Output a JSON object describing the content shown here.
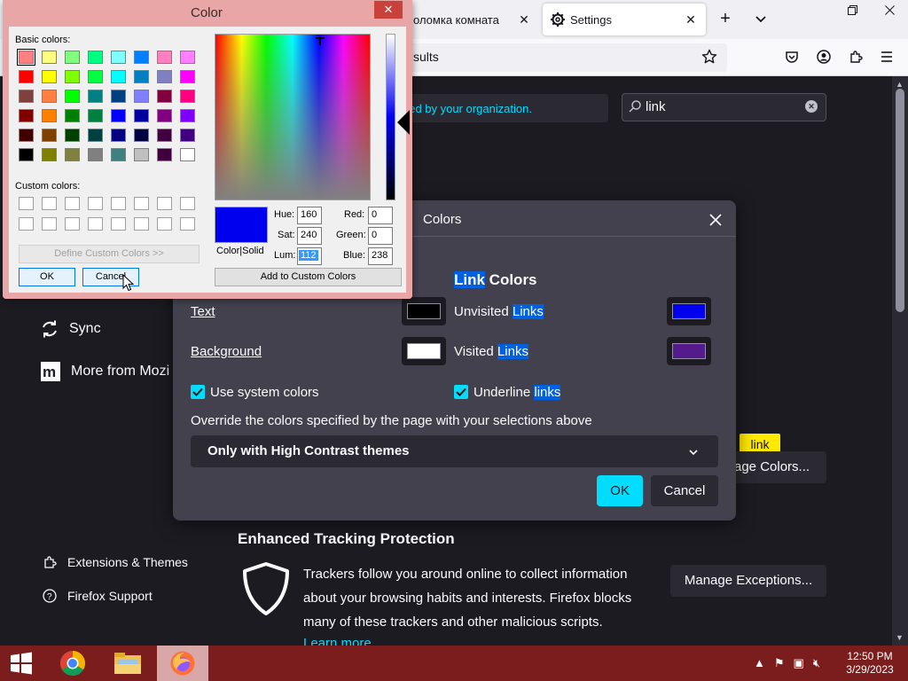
{
  "browser": {
    "tabs": [
      {
        "label": "оломка комната"
      },
      {
        "label": "Settings"
      }
    ],
    "url_fragment": "sults"
  },
  "settings": {
    "managed_text": "ged by your organization.",
    "search": {
      "value": "link"
    },
    "sidebar": {
      "sync": "Sync",
      "more_from": "More from Mozi",
      "extensions": "Extensions & Themes",
      "support": "Firefox Support"
    },
    "etp": {
      "title": "Enhanced Tracking Protection",
      "description": "Trackers follow you around online to collect information about your browsing habits and interests. Firefox blocks many of these trackers and other malicious scripts.",
      "learn_more": "Learn more",
      "manage_exceptions": "Manage Exceptions..."
    },
    "manage_colors_partial": "age Colors...",
    "tooltip": "link"
  },
  "colors_dialog": {
    "title": "Colors",
    "link_colors_heading_pre": "",
    "link_colors_heading_hl": "Link",
    "link_colors_heading_post": " Colors",
    "text_label": "Text",
    "background_label": "Background",
    "unvisited_pre": "Unvisited ",
    "unvisited_hl": "Links",
    "visited_pre": "Visited ",
    "visited_hl": "Links",
    "use_system_colors": "Use system colors",
    "underline_pre": "Underline ",
    "underline_hl": "links",
    "override_label": "Override the colors specified by the page with your selections above",
    "override_value": "Only with High Contrast themes",
    "ok": "OK",
    "cancel": "Cancel",
    "colors": {
      "text": "#000000",
      "background": "#ffffff",
      "unvisited": "#0000ee",
      "visited": "#551a8b"
    }
  },
  "color_picker": {
    "title": "Color",
    "basic_colors_label": "Basic colors:",
    "custom_colors_label": "Custom colors:",
    "define_custom": "Define Custom Colors >>",
    "ok": "OK",
    "cancel": "Cancel",
    "add_custom": "Add to Custom Colors",
    "color_solid": "Color|Solid",
    "hue_label": "Hue:",
    "sat_label": "Sat:",
    "lum_label": "Lum:",
    "red_label": "Red:",
    "green_label": "Green:",
    "blue_label": "Blue:",
    "hue": "160",
    "sat": "240",
    "lum": "112",
    "red": "0",
    "green": "0",
    "blue": "238",
    "basic_colors": [
      "#ff8080",
      "#ffff80",
      "#80ff80",
      "#00ff80",
      "#80ffff",
      "#0080ff",
      "#ff80c0",
      "#ff80ff",
      "#ff0000",
      "#ffff00",
      "#80ff00",
      "#00ff40",
      "#00ffff",
      "#0080c0",
      "#8080c0",
      "#ff00ff",
      "#804040",
      "#ff8040",
      "#00ff00",
      "#008080",
      "#004080",
      "#8080ff",
      "#800040",
      "#ff0080",
      "#800000",
      "#ff8000",
      "#008000",
      "#008040",
      "#0000ff",
      "#0000a0",
      "#800080",
      "#8000ff",
      "#400000",
      "#804000",
      "#004000",
      "#004040",
      "#000080",
      "#000040",
      "#400040",
      "#400080",
      "#000000",
      "#808000",
      "#808040",
      "#808080",
      "#408080",
      "#c0c0c0",
      "#400040",
      "#ffffff"
    ]
  },
  "taskbar": {
    "time": "12:50 PM",
    "date": "3/29/2023"
  }
}
